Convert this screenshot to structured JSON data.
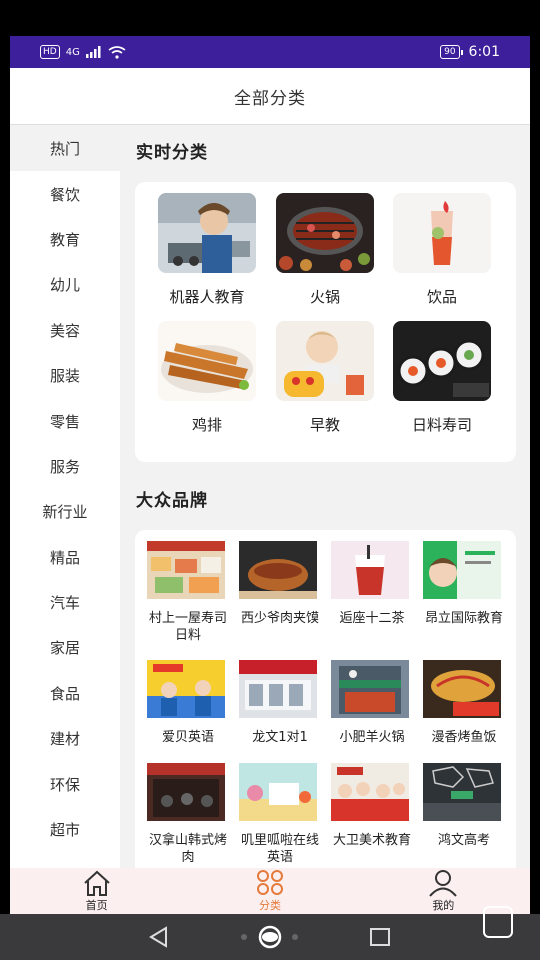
{
  "status": {
    "hd": "HD",
    "signal": "4G",
    "battery": "90",
    "time": "6:01"
  },
  "header": {
    "title": "全部分类"
  },
  "sidebar": {
    "items": [
      {
        "label": "热门",
        "active": true
      },
      {
        "label": "餐饮"
      },
      {
        "label": "教育"
      },
      {
        "label": "幼儿"
      },
      {
        "label": "美容"
      },
      {
        "label": "服装"
      },
      {
        "label": "零售"
      },
      {
        "label": "服务"
      },
      {
        "label": "新行业"
      },
      {
        "label": "精品"
      },
      {
        "label": "汽车"
      },
      {
        "label": "家居"
      },
      {
        "label": "食品"
      },
      {
        "label": "建材"
      },
      {
        "label": "环保"
      },
      {
        "label": "超市"
      }
    ]
  },
  "realtime": {
    "title": "实时分类",
    "items": [
      {
        "label": "机器人教育",
        "icon": "robot-education-photo"
      },
      {
        "label": "火锅",
        "icon": "hotpot-photo"
      },
      {
        "label": "饮品",
        "icon": "drink-photo"
      },
      {
        "label": "鸡排",
        "icon": "chicken-cutlet-photo"
      },
      {
        "label": "早教",
        "icon": "early-education-photo"
      },
      {
        "label": "日料寿司",
        "icon": "sushi-photo"
      }
    ]
  },
  "brands": {
    "title": "大众品牌",
    "items": [
      {
        "label": "村上一屋寿司日料"
      },
      {
        "label": "西少爷肉夹馍"
      },
      {
        "label": "逅座十二茶"
      },
      {
        "label": "昂立国际教育"
      },
      {
        "label": "爱贝英语"
      },
      {
        "label": "龙文1对1"
      },
      {
        "label": "小肥羊火锅"
      },
      {
        "label": "漫香烤鱼饭"
      },
      {
        "label": "汉拿山韩式烤肉"
      },
      {
        "label": "叽里呱啦在线英语"
      },
      {
        "label": "大卫美术教育"
      },
      {
        "label": "鸿文高考"
      }
    ]
  },
  "bottom_nav": {
    "items": [
      {
        "label": "首页",
        "icon": "home-icon"
      },
      {
        "label": "分类",
        "icon": "category-icon",
        "active": true
      },
      {
        "label": "我的",
        "icon": "profile-icon"
      }
    ]
  },
  "colors": {
    "statusbar": "#3d1f9b",
    "accent": "#e57a3b",
    "nav_bg": "#fbeff0"
  }
}
